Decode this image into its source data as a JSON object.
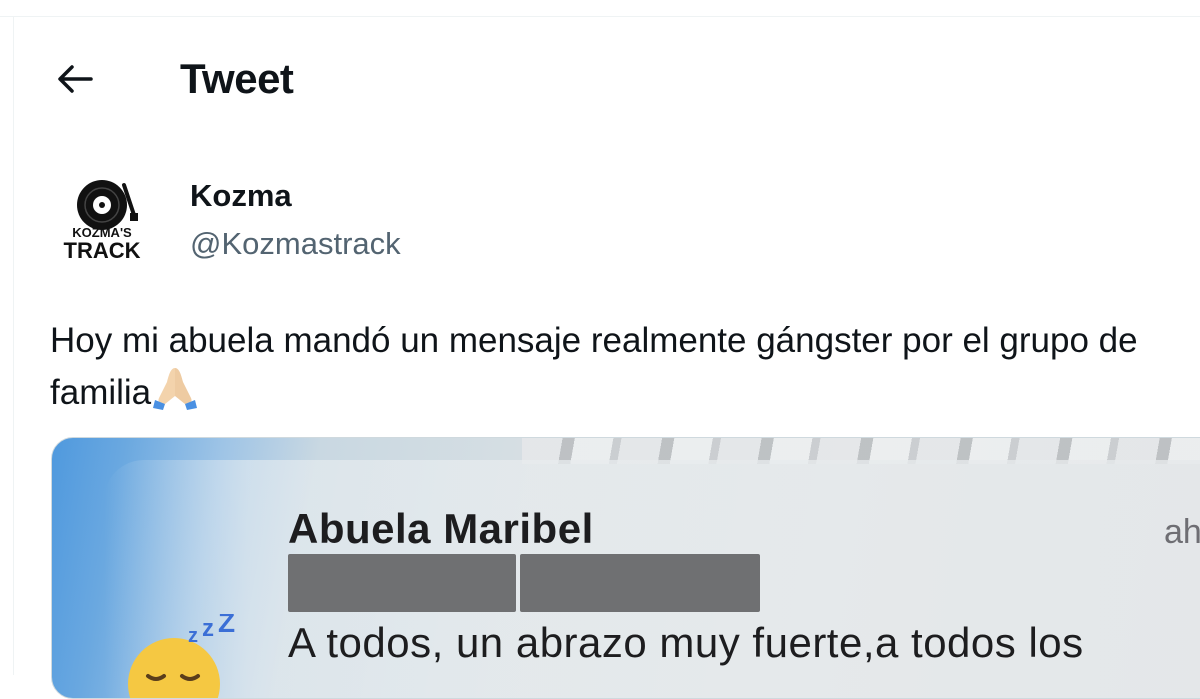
{
  "header": {
    "back_icon": "arrow-left-icon",
    "title": "Tweet"
  },
  "author": {
    "avatar_text_top": "KOZMA'S",
    "avatar_text_bottom": "TRACK",
    "display_name": "Kozma",
    "handle": "@Kozmastrack"
  },
  "tweet": {
    "line1": "Hoy mi abuela mandó un mensaje realmente gángster por el grupo de",
    "line2": "familia",
    "emoji": "folded-hands-icon"
  },
  "media": {
    "sender": "Abuela Maribel",
    "time": "ahora",
    "message": "A todos, un abrazo muy fuerte,a todos los",
    "emoji": "sleeping-face-icon",
    "accent": "#4f99de"
  },
  "colors": {
    "text": "#0f1419",
    "secondary": "#536471",
    "border": "#eff3f4",
    "redaction": "#6f7072"
  }
}
